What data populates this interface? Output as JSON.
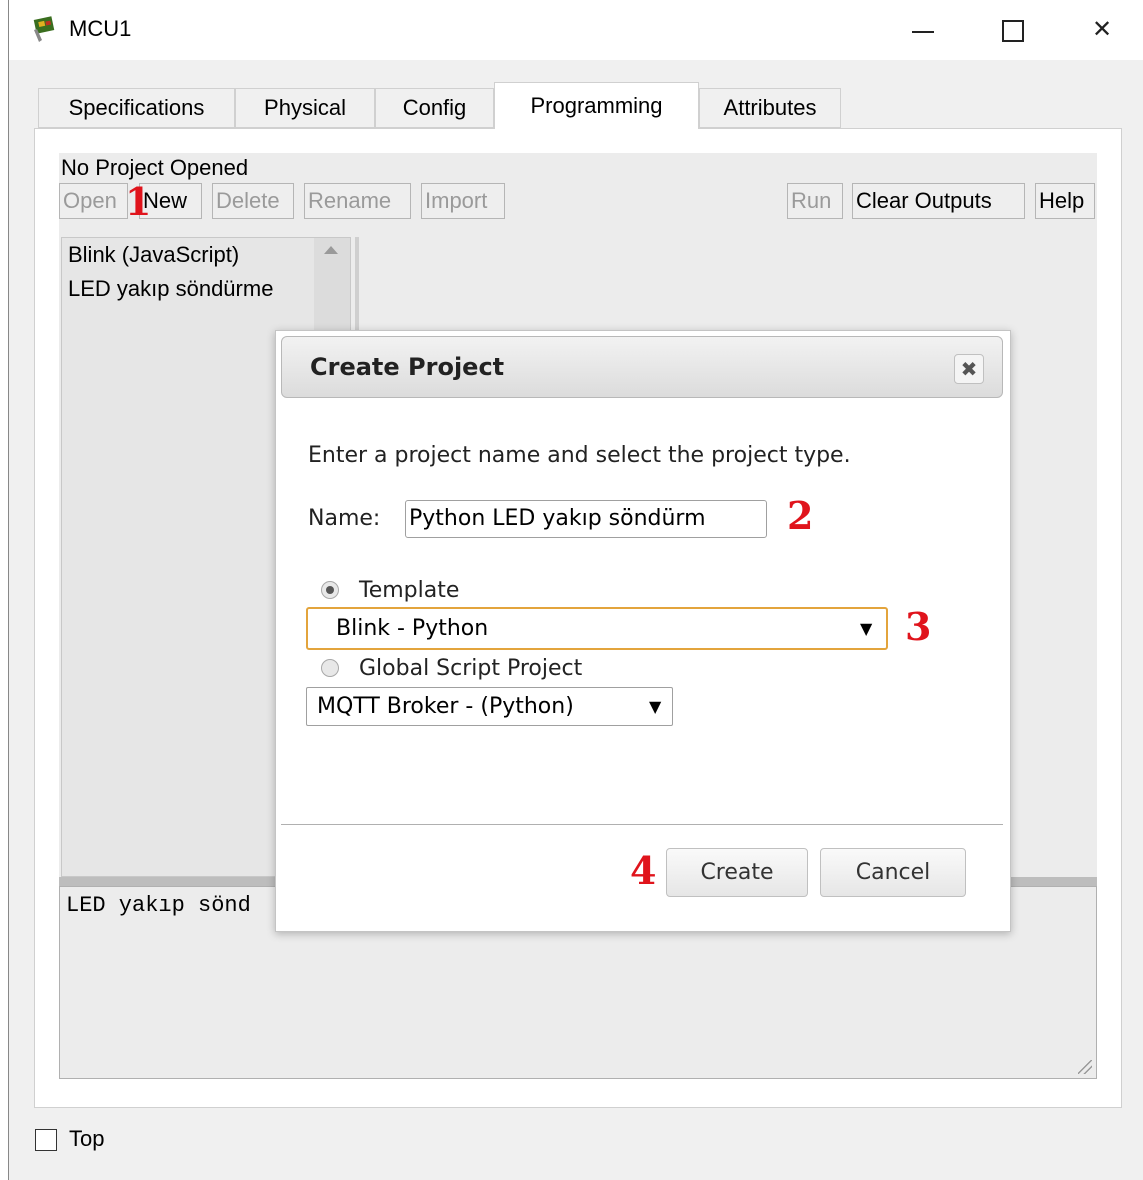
{
  "window": {
    "title": "MCU1",
    "controls": {
      "minimize": "—",
      "maximize": "☐",
      "close": "✕"
    }
  },
  "tabs": [
    {
      "label": "Specifications",
      "active": false
    },
    {
      "label": "Physical",
      "active": false
    },
    {
      "label": "Config",
      "active": false
    },
    {
      "label": "Programming",
      "active": true
    },
    {
      "label": "Attributes",
      "active": false
    }
  ],
  "programming": {
    "status": "No Project Opened",
    "toolbar": {
      "open": "Open",
      "new": "New",
      "delete": "Delete",
      "rename": "Rename",
      "import": "Import",
      "run": "Run",
      "clear_outputs": "Clear Outputs",
      "help": "Help"
    },
    "projects": [
      "Blink (JavaScript)",
      "LED yakıp söndürme"
    ],
    "output_text": "LED yakıp sönd"
  },
  "dialog": {
    "title": "Create Project",
    "close_icon": "✖",
    "instruction": "Enter a project name and select the project type.",
    "name_label": "Name:",
    "name_value": "Python LED yakıp söndürm",
    "template_label": "Template",
    "template_selected": "Blink - Python",
    "global_label": "Global Script Project",
    "global_selected": "MQTT Broker - (Python)",
    "dropdown_arrow": "▼",
    "create_label": "Create",
    "cancel_label": "Cancel"
  },
  "annotations": [
    "1",
    "2",
    "3",
    "4"
  ],
  "footer": {
    "top_label": "Top",
    "top_checked": false
  },
  "colors": {
    "annotation": "#e0141c",
    "focus_border": "#e3a43c",
    "disabled_text": "#9a9a9a"
  }
}
